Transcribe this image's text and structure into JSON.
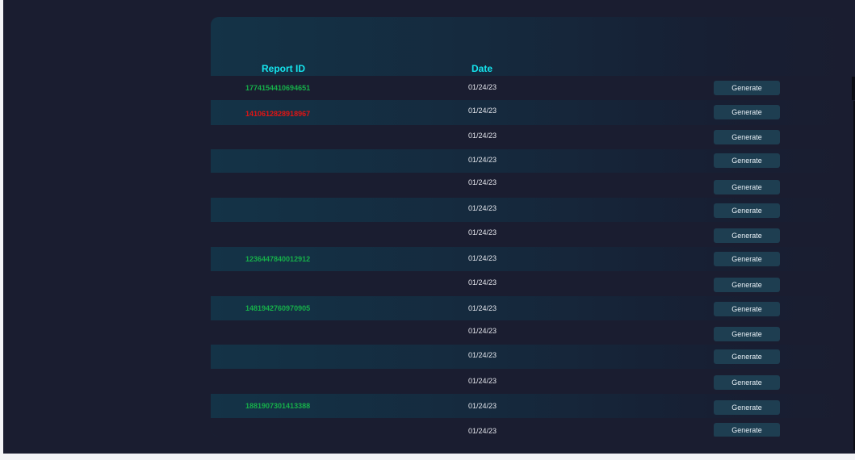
{
  "table": {
    "columns": {
      "report_id": "Report ID",
      "date": "Date"
    },
    "button_label": "Generate",
    "status_colors": {
      "success": "#16b04a",
      "error": "#e01414"
    },
    "rows": [
      {
        "report_id": "1774154410694651",
        "status": "success",
        "date": "01/24/23"
      },
      {
        "report_id": "1410612828918967",
        "status": "error",
        "date": "01/24/23"
      },
      {
        "report_id": "",
        "status": "",
        "date": "01/24/23"
      },
      {
        "report_id": "",
        "status": "",
        "date": "01/24/23"
      },
      {
        "report_id": "",
        "status": "",
        "date": "01/24/23"
      },
      {
        "report_id": "",
        "status": "",
        "date": "01/24/23"
      },
      {
        "report_id": "",
        "status": "",
        "date": "01/24/23"
      },
      {
        "report_id": "1236447840012912",
        "status": "success",
        "date": "01/24/23"
      },
      {
        "report_id": "",
        "status": "",
        "date": "01/24/23"
      },
      {
        "report_id": "1481942760970905",
        "status": "success",
        "date": "01/24/23"
      },
      {
        "report_id": "",
        "status": "",
        "date": "01/24/23"
      },
      {
        "report_id": "",
        "status": "",
        "date": "01/24/23"
      },
      {
        "report_id": "",
        "status": "",
        "date": "01/24/23"
      },
      {
        "report_id": "1881907301413388",
        "status": "success",
        "date": "01/24/23"
      },
      {
        "report_id": "",
        "status": "",
        "date": "01/24/23"
      }
    ]
  }
}
